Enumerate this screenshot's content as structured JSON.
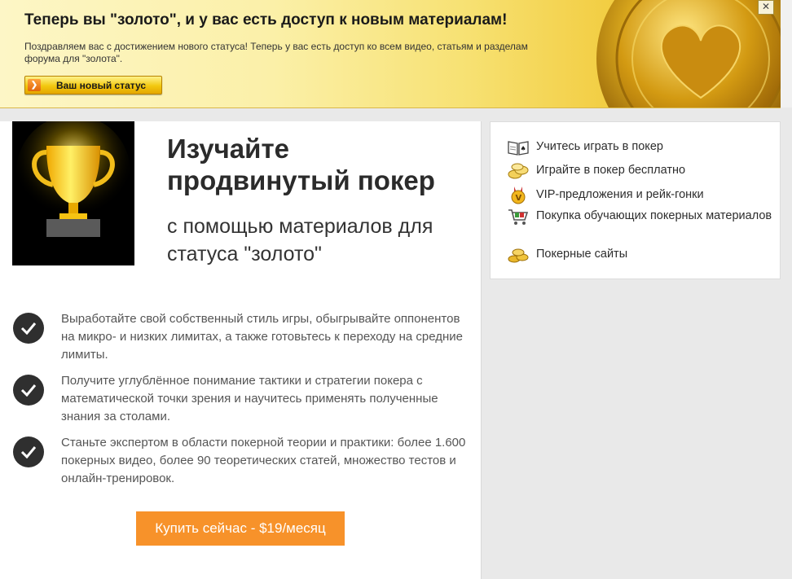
{
  "banner": {
    "title": "Теперь вы \"золото\", и у вас есть доступ к новым материалам!",
    "text": "Поздравляем вас с достижением нового статуса! Теперь у вас есть доступ ко всем видео, статьям и разделам форума для \"золота\".",
    "button_label": "Ваш новый статус",
    "close_label": "✕"
  },
  "main": {
    "headline": "Изучайте продвинутый покер",
    "subline": "с помощью материалов для статуса \"золото\"",
    "features": [
      "Выработайте свой собственный стиль игры, обыгрывайте оппонентов на микро- и низких лимитах, а также готовьтесь к переходу на средние лимиты.",
      "Получите углублённое понимание тактики и стратегии покера с математической точки зрения и научитесь применять полученные знания за столами.",
      "Станьте экспертом в области покерной теории и практики: более 1.600 покерных видео, более 90 теоретических статей, множество тестов и онлайн-тренировок."
    ],
    "buy_label": "Купить сейчас - $19/месяц"
  },
  "sidebar": {
    "items": [
      {
        "label": "Учитесь играть в покер",
        "icon": "book-icon"
      },
      {
        "label": "Играйте в покер бесплатно",
        "icon": "chips-icon"
      },
      {
        "label": "VIP-предложения и рейк-гонки",
        "icon": "vip-medal-icon"
      },
      {
        "label": "Покупка обучающих покерных материалов",
        "icon": "shopping-cart-icon"
      },
      {
        "label": "Покерные сайты",
        "icon": "coins-icon"
      }
    ]
  },
  "colors": {
    "accent_orange": "#f7922a",
    "gold": "#f2c80f",
    "check_dark": "#2f2f2f"
  }
}
